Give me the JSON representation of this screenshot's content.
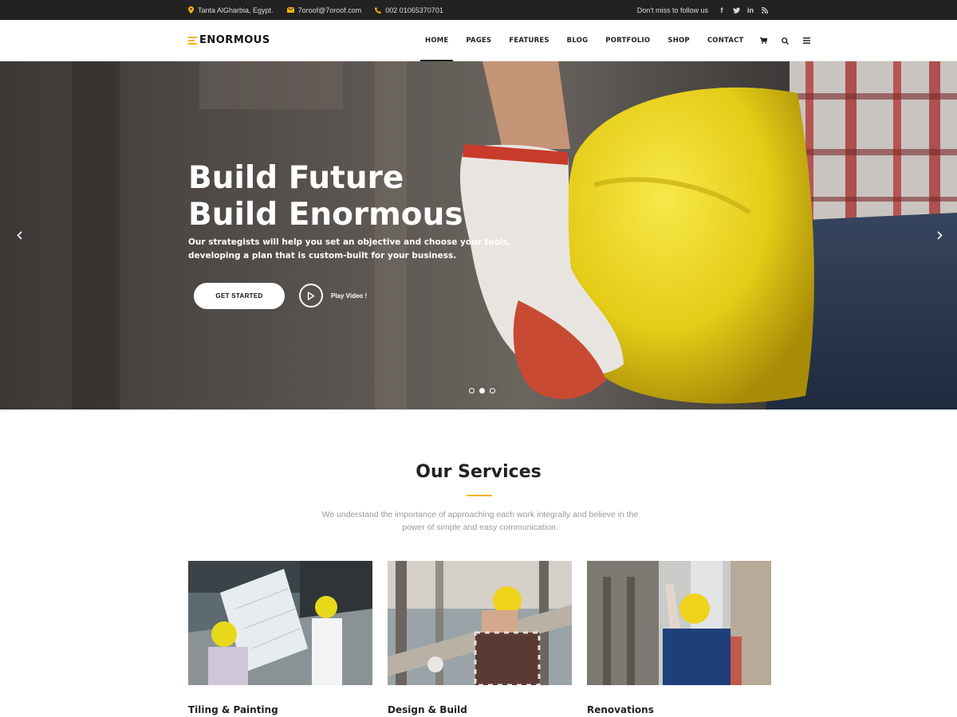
{
  "topbar": {
    "address": "Tanta AlGharbia, Egypt.",
    "email": "7oroof@7oroof.com",
    "phone": "002 01065370701",
    "follow_text": "Don't miss to follow us",
    "social": [
      "facebook-icon",
      "twitter-icon",
      "linkedin-icon",
      "rss-icon"
    ]
  },
  "header": {
    "logo": "ENORMOUS",
    "nav": [
      "HOME",
      "PAGES",
      "FEATURES",
      "BLOG",
      "PORTFOLIO",
      "SHOP",
      "CONTACT"
    ],
    "active_nav": "HOME",
    "icons": [
      "cart-icon",
      "search-icon",
      "menu-icon"
    ]
  },
  "hero": {
    "title_line1": "Build Future",
    "title_line2": "Build Enormous",
    "subtitle": "Our strategists will help you set an objective and choose your tools, developing a plan that is custom-built for your business.",
    "cta_label": "GET STARTED",
    "video_label": "Play Video !",
    "slide_count": 3,
    "active_slide": 2
  },
  "services": {
    "title": "Our Services",
    "description": "We understand the importance of approaching each work integrally and believe in the power of simple and easy communication.",
    "items": [
      {
        "title": "Tiling & Painting"
      },
      {
        "title": "Design & Build"
      },
      {
        "title": "Renovations"
      }
    ]
  },
  "colors": {
    "accent": "#f5b50a",
    "topbar_bg": "#222222"
  }
}
